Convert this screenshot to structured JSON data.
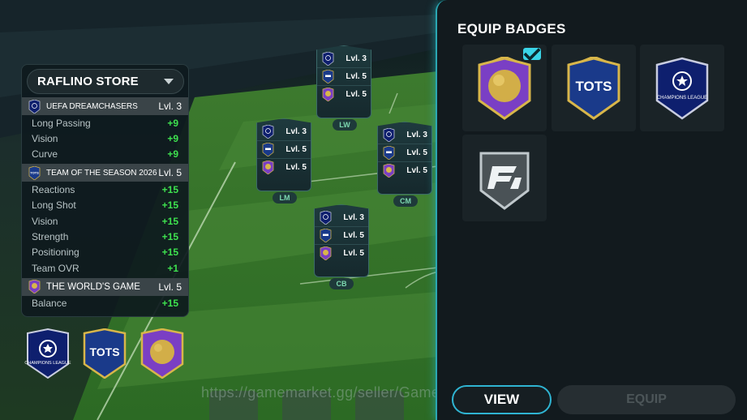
{
  "store": {
    "title": "RAFLINO STORE",
    "groups": [
      {
        "badge": "ucl-badge-icon",
        "name": "UEFA DREAMCHASERS",
        "level": "Lvl. 3",
        "stats": [
          {
            "name": "Long Passing",
            "value": "+9"
          },
          {
            "name": "Vision",
            "value": "+9"
          },
          {
            "name": "Curve",
            "value": "+9"
          }
        ]
      },
      {
        "badge": "tots-badge-icon",
        "name": "TEAM OF THE SEASON 2026",
        "level": "Lvl. 5",
        "stats": [
          {
            "name": "Reactions",
            "value": "+15"
          },
          {
            "name": "Long Shot",
            "value": "+15"
          },
          {
            "name": "Vision",
            "value": "+15"
          },
          {
            "name": "Strength",
            "value": "+15"
          },
          {
            "name": "Positioning",
            "value": "+15"
          },
          {
            "name": "Team OVR",
            "value": "+1"
          }
        ]
      },
      {
        "badge": "worlds-game-badge-icon",
        "name": "THE WORLD'S GAME",
        "level": "Lvl. 5",
        "stats": [
          {
            "name": "Balance",
            "value": "+15"
          }
        ]
      }
    ]
  },
  "player_cards": [
    {
      "position": "LW",
      "rows": [
        "Lvl. 3",
        "Lvl. 5",
        "Lvl. 5"
      ]
    },
    {
      "position": "LM",
      "rows": [
        "Lvl. 3",
        "Lvl. 5",
        "Lvl. 5"
      ]
    },
    {
      "position": "CM",
      "rows": [
        "Lvl. 3",
        "Lvl. 5",
        "Lvl. 5"
      ]
    },
    {
      "position": "CB",
      "rows": [
        "Lvl. 3",
        "Lvl. 5",
        "Lvl. 5"
      ]
    }
  ],
  "equip_panel": {
    "title": "EQUIP BADGES",
    "badges": [
      {
        "icon": "worlds-game-badge-icon",
        "selected": true
      },
      {
        "icon": "tots-badge-icon",
        "label": "TOTS",
        "selected": false
      },
      {
        "icon": "ucl-badge-icon",
        "label": "CHAMPIONS LEAGUE",
        "selected": false
      },
      {
        "icon": "fc-badge-icon",
        "selected": false
      }
    ],
    "view_label": "VIEW",
    "equip_label": "EQUIP"
  },
  "bottom_badges": [
    {
      "icon": "ucl-badge-icon",
      "label": "CHAMPIONS LEAGUE"
    },
    {
      "icon": "tots-badge-icon",
      "label": "TOTS"
    },
    {
      "icon": "worlds-game-badge-icon"
    }
  ],
  "watermark": "https://gamemarket.gg/seller/GameNews",
  "colors": {
    "accent": "#2fb4d2",
    "stat_positive": "#3ee24f",
    "panel_bg": "#121a1e",
    "tots_blue": "#1a3a8a",
    "ucl_navy": "#0e1f6e",
    "gold": "#d8b64a",
    "purple": "#7a3fc4"
  }
}
